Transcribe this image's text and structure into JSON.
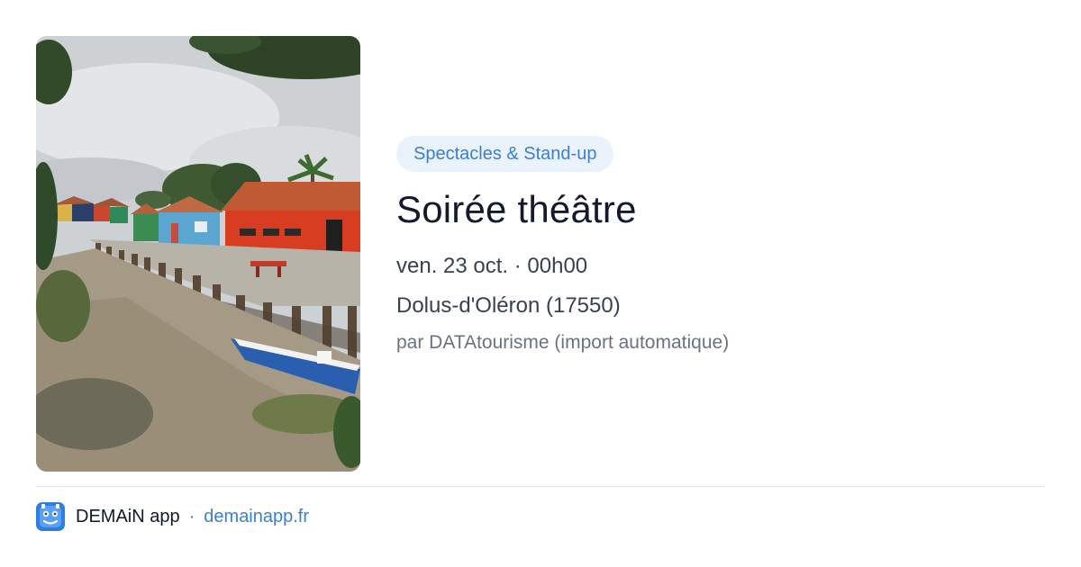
{
  "event": {
    "category": "Spectacles & Stand-up",
    "title": "Soirée théâtre",
    "datetime": "ven. 23 oct. · 00h00",
    "location": "Dolus-d'Oléron (17550)",
    "source": "par DATAtourisme (import automatique)"
  },
  "footer": {
    "app_name": "DEMAiN app",
    "separator": "·",
    "url": "demainapp.fr"
  },
  "colors": {
    "accent": "#3b7fd1",
    "category_bg": "#eaf2fc",
    "title": "#141a2e",
    "text": "#374151",
    "muted": "#6b7280"
  },
  "icons": {
    "logo": "demain-app-logo-icon"
  }
}
